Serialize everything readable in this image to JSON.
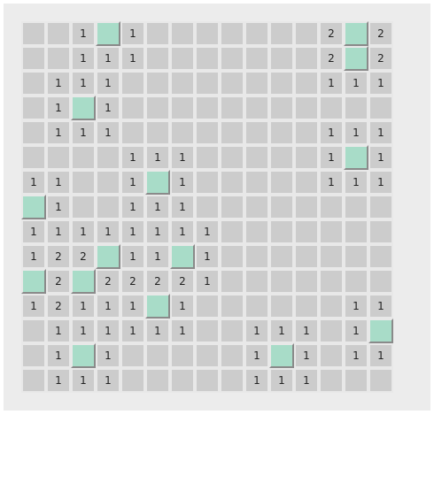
{
  "board": {
    "rows": 15,
    "cols": 15,
    "colors": {
      "cell": "#cccccc",
      "mine_cell": "#a8dcc8",
      "grid_line": "#e8e8e8",
      "frame": "#ececec"
    },
    "legend": {
      "empty": "",
      "number": "revealed count",
      "M": "highlighted tile"
    },
    "cells": [
      [
        "",
        "",
        "1",
        "M",
        "1",
        "",
        "",
        "",
        "",
        "",
        "",
        "",
        "2",
        "M",
        "2"
      ],
      [
        "",
        "",
        "1",
        "1",
        "1",
        "",
        "",
        "",
        "",
        "",
        "",
        "",
        "2",
        "M",
        "2"
      ],
      [
        "",
        "1",
        "1",
        "1",
        "",
        "",
        "",
        "",
        "",
        "",
        "",
        "",
        "1",
        "1",
        "1"
      ],
      [
        "",
        "1",
        "M",
        "1",
        "",
        "",
        "",
        "",
        "",
        "",
        "",
        "",
        "",
        "",
        ""
      ],
      [
        "",
        "1",
        "1",
        "1",
        "",
        "",
        "",
        "",
        "",
        "",
        "",
        "",
        "1",
        "1",
        "1"
      ],
      [
        "",
        "",
        "",
        "",
        "1",
        "1",
        "1",
        "",
        "",
        "",
        "",
        "",
        "1",
        "M",
        "1"
      ],
      [
        "1",
        "1",
        "",
        "",
        "1",
        "M",
        "1",
        "",
        "",
        "",
        "",
        "",
        "1",
        "1",
        "1"
      ],
      [
        "M",
        "1",
        "",
        "",
        "1",
        "1",
        "1",
        "",
        "",
        "",
        "",
        "",
        "",
        "",
        ""
      ],
      [
        "1",
        "1",
        "1",
        "1",
        "1",
        "1",
        "1",
        "1",
        "",
        "",
        "",
        "",
        "",
        "",
        ""
      ],
      [
        "1",
        "2",
        "2",
        "M",
        "1",
        "1",
        "M",
        "1",
        "",
        "",
        "",
        "",
        "",
        "",
        ""
      ],
      [
        "M",
        "2",
        "M",
        "2",
        "2",
        "2",
        "2",
        "1",
        "",
        "",
        "",
        "",
        "",
        "",
        ""
      ],
      [
        "1",
        "2",
        "1",
        "1",
        "1",
        "M",
        "1",
        "",
        "",
        "",
        "",
        "",
        "",
        "1",
        "1"
      ],
      [
        "",
        "1",
        "1",
        "1",
        "1",
        "1",
        "1",
        "",
        "",
        "1",
        "1",
        "1",
        "",
        "1",
        "M"
      ],
      [
        "",
        "1",
        "M",
        "1",
        "",
        "",
        "",
        "",
        "",
        "1",
        "M",
        "1",
        "",
        "1",
        "1"
      ],
      [
        "",
        "1",
        "1",
        "1",
        "",
        "",
        "",
        "",
        "",
        "1",
        "1",
        "1",
        "",
        "",
        ""
      ]
    ]
  }
}
